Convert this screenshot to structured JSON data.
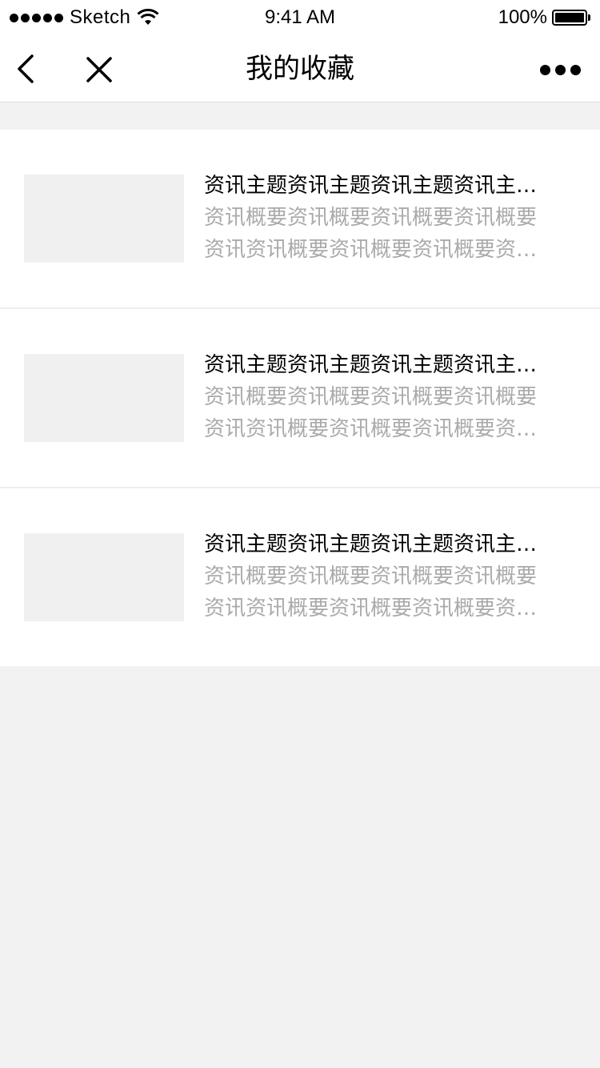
{
  "status_bar": {
    "carrier": "Sketch",
    "time": "9:41 AM",
    "battery": "100%",
    "battery_level": 1.0
  },
  "nav": {
    "title": "我的收藏",
    "icons": [
      "back-icon",
      "close-icon",
      "more-icon"
    ]
  },
  "favorites": [
    {
      "title": "资讯主题资讯主题资讯主题资讯主题资讯主题",
      "summary": "资讯概要资讯概要资讯概要资讯概要资讯资讯概要资讯概要资讯概要资讯概要"
    },
    {
      "title": "资讯主题资讯主题资讯主题资讯主题资讯主题",
      "summary": "资讯概要资讯概要资讯概要资讯概要资讯资讯概要资讯概要资讯概要资讯概要"
    },
    {
      "title": "资讯主题资讯主题资讯主题资讯主题资讯主题",
      "summary": "资讯概要资讯概要资讯概要资讯概要资讯资讯概要资讯概要资讯概要资讯概要"
    }
  ],
  "colors": {
    "background": "#f2f2f2",
    "card": "#ffffff",
    "summary_text": "#aaaaaa",
    "thumbnail_placeholder": "#f0f0f0"
  }
}
